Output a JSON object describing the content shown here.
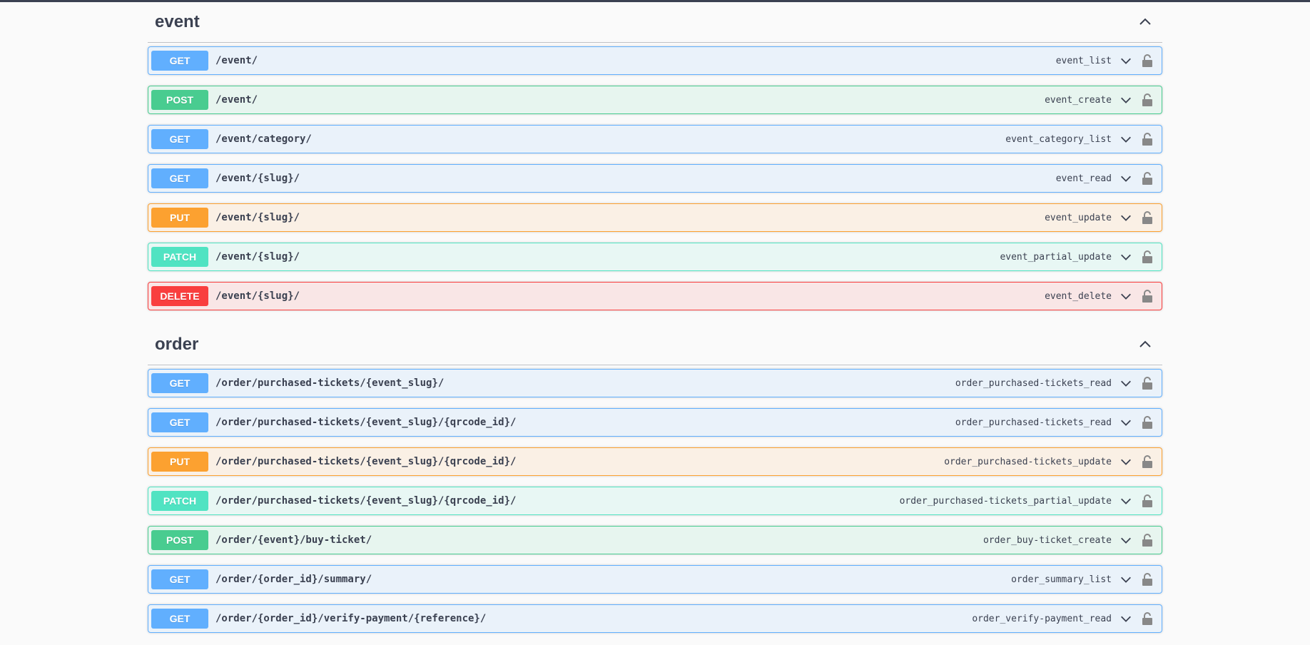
{
  "sections": [
    {
      "title": "event",
      "operations": [
        {
          "method": "GET",
          "path": "/event/",
          "op_id": "event_list"
        },
        {
          "method": "POST",
          "path": "/event/",
          "op_id": "event_create"
        },
        {
          "method": "GET",
          "path": "/event/category/",
          "op_id": "event_category_list"
        },
        {
          "method": "GET",
          "path": "/event/{slug}/",
          "op_id": "event_read"
        },
        {
          "method": "PUT",
          "path": "/event/{slug}/",
          "op_id": "event_update"
        },
        {
          "method": "PATCH",
          "path": "/event/{slug}/",
          "op_id": "event_partial_update"
        },
        {
          "method": "DELETE",
          "path": "/event/{slug}/",
          "op_id": "event_delete"
        }
      ]
    },
    {
      "title": "order",
      "operations": [
        {
          "method": "GET",
          "path": "/order/purchased-tickets/{event_slug}/",
          "op_id": "order_purchased-tickets_read"
        },
        {
          "method": "GET",
          "path": "/order/purchased-tickets/{event_slug}/{qrcode_id}/",
          "op_id": "order_purchased-tickets_read"
        },
        {
          "method": "PUT",
          "path": "/order/purchased-tickets/{event_slug}/{qrcode_id}/",
          "op_id": "order_purchased-tickets_update"
        },
        {
          "method": "PATCH",
          "path": "/order/purchased-tickets/{event_slug}/{qrcode_id}/",
          "op_id": "order_purchased-tickets_partial_update"
        },
        {
          "method": "POST",
          "path": "/order/{event}/buy-ticket/",
          "op_id": "order_buy-ticket_create"
        },
        {
          "method": "GET",
          "path": "/order/{order_id}/summary/",
          "op_id": "order_summary_list"
        },
        {
          "method": "GET",
          "path": "/order/{order_id}/verify-payment/{reference}/",
          "op_id": "order_verify-payment_read"
        }
      ]
    }
  ],
  "colors": {
    "get": "#61affe",
    "post": "#49cc90",
    "put": "#fca130",
    "patch": "#50e3c2",
    "delete": "#f93e3e"
  },
  "icons": {
    "collapse": "chevron-up-icon",
    "expand": "chevron-down-icon",
    "auth": "unlocked-padlock-icon"
  }
}
